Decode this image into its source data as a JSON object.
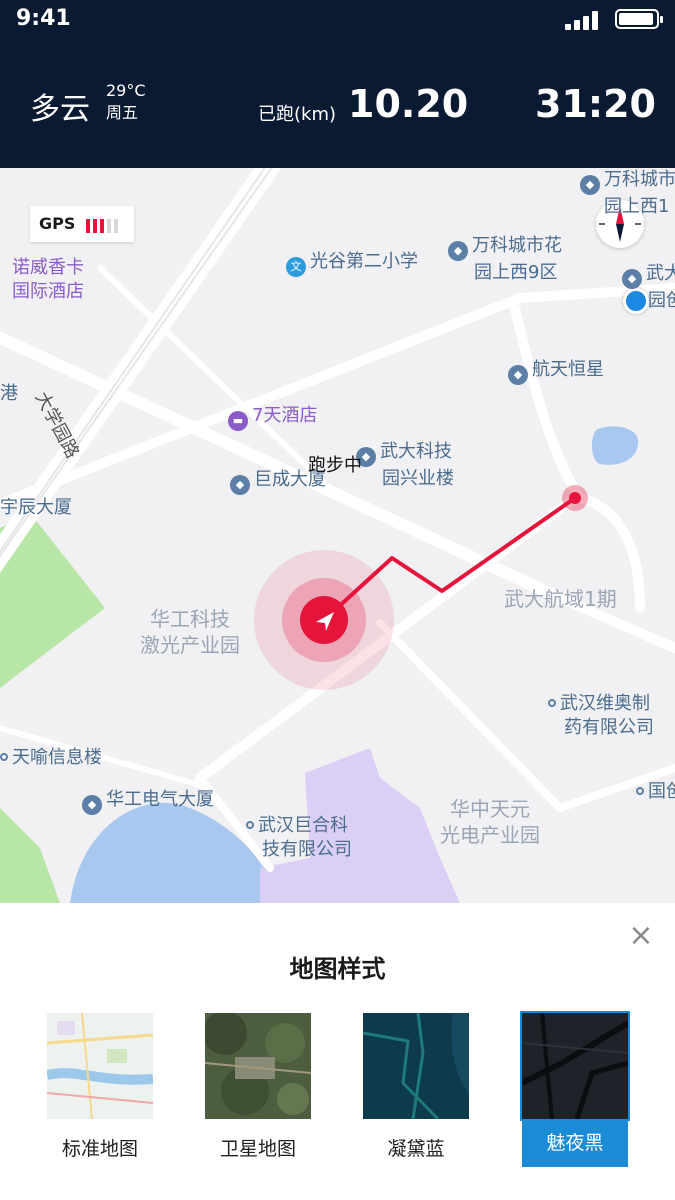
{
  "status_bar": {
    "time": "9:41"
  },
  "header": {
    "weather": "多云",
    "temperature": "29°C",
    "weekday": "周五",
    "run_label": "已跑(km)",
    "distance": "10.20",
    "duration": "31:20"
  },
  "map": {
    "gps_label": "GPS",
    "gps_strength": 0.6,
    "running_label": "跑步中",
    "pois": {
      "p1": "万科城市",
      "p1b": "园上西1",
      "p2": "光谷第二小学",
      "p3a": "万科城市花",
      "p3b": "园上西9区",
      "p4a": "武大",
      "p4b": "园创",
      "p5a": "诺威香卡",
      "p5b": "国际酒店",
      "p6": "航天恒星",
      "p7": "7天酒店",
      "p8a": "武大科技",
      "p8b": "园兴业楼",
      "p9": "巨成大厦",
      "p10": "大学园路",
      "p11": "港",
      "p12": "宇辰大厦",
      "p13": "武大航域1期",
      "p14a": "华工科技",
      "p14b": "激光产业园",
      "p15a": "武汉维奥制",
      "p15b": "药有限公司",
      "p16": "天喻信息楼",
      "p17": "华工电气大厦",
      "p18": "国创",
      "p19a": "武汉巨合科",
      "p19b": "技有限公司",
      "p20a": "华中天元",
      "p20b": "光电产业园"
    }
  },
  "sheet": {
    "title": "地图样式",
    "close_icon": "close-icon",
    "options": [
      {
        "label": "标准地图"
      },
      {
        "label": "卫星地图"
      },
      {
        "label": "凝黛蓝"
      },
      {
        "label": "魅夜黑"
      }
    ],
    "selected_index": 3
  },
  "colors": {
    "header_bg": "#0b1a33",
    "route": "#e6133b",
    "accent": "#1c8bd6"
  }
}
